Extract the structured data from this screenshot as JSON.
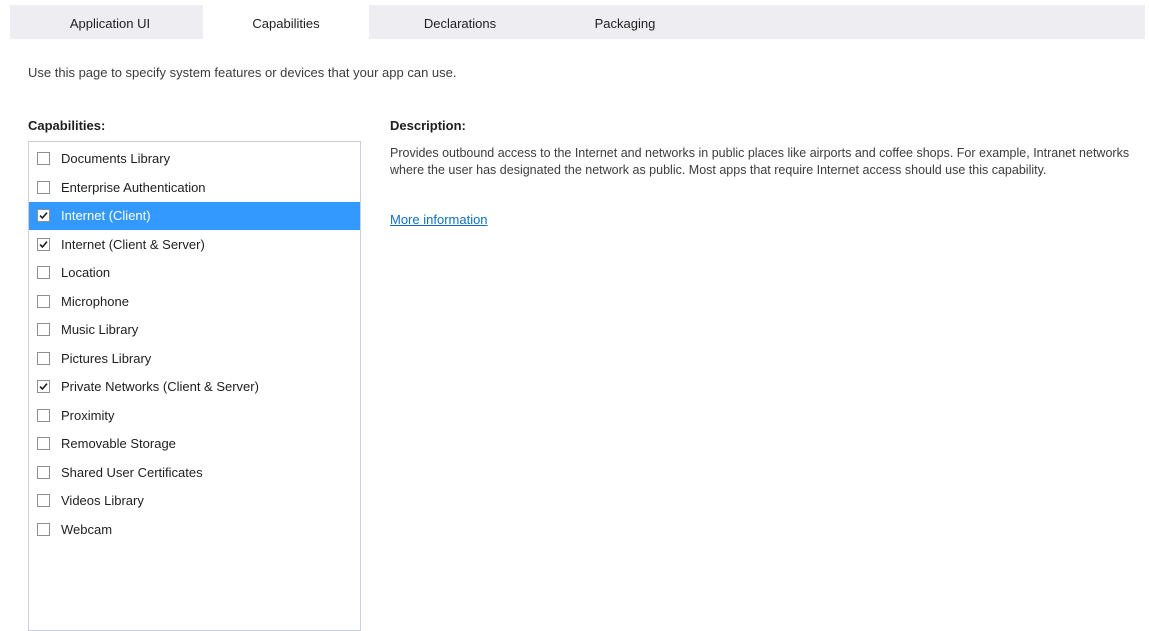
{
  "tabs": [
    {
      "label": "Application UI",
      "active": false
    },
    {
      "label": "Capabilities",
      "active": true
    },
    {
      "label": "Declarations",
      "active": false
    },
    {
      "label": "Packaging",
      "active": false
    }
  ],
  "intro_text": "Use this page to specify system features or devices that your app can use.",
  "capabilities_label": "Capabilities:",
  "description_label": "Description:",
  "description_text": "Provides outbound access to the Internet and networks in public places like airports and coffee shops. For example, Intranet networks where the user has designated the network as public. Most apps that require Internet access should use this capability.",
  "more_info_link": "More information",
  "capabilities": [
    {
      "label": "Documents Library",
      "checked": false,
      "selected": false
    },
    {
      "label": "Enterprise Authentication",
      "checked": false,
      "selected": false
    },
    {
      "label": "Internet (Client)",
      "checked": true,
      "selected": true
    },
    {
      "label": "Internet (Client & Server)",
      "checked": true,
      "selected": false
    },
    {
      "label": "Location",
      "checked": false,
      "selected": false
    },
    {
      "label": "Microphone",
      "checked": false,
      "selected": false
    },
    {
      "label": "Music Library",
      "checked": false,
      "selected": false
    },
    {
      "label": "Pictures Library",
      "checked": false,
      "selected": false
    },
    {
      "label": "Private Networks (Client & Server)",
      "checked": true,
      "selected": false
    },
    {
      "label": "Proximity",
      "checked": false,
      "selected": false
    },
    {
      "label": "Removable Storage",
      "checked": false,
      "selected": false
    },
    {
      "label": "Shared User Certificates",
      "checked": false,
      "selected": false
    },
    {
      "label": "Videos Library",
      "checked": false,
      "selected": false
    },
    {
      "label": "Webcam",
      "checked": false,
      "selected": false
    }
  ],
  "colors": {
    "selection": "#3399ff",
    "link": "#0e70c0",
    "tabstrip": "#eeeef2"
  }
}
